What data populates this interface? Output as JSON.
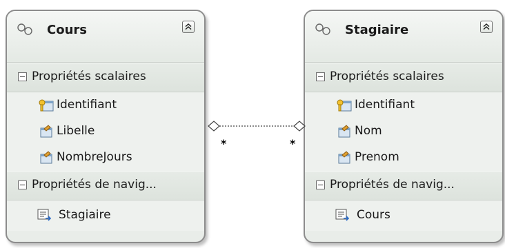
{
  "entities": [
    {
      "title": "Cours",
      "sections": {
        "scalar_label": "Propriétés scalaires",
        "nav_label": "Propriétés de navig..."
      },
      "properties": [
        {
          "name": "Identifiant",
          "icon": "key-property-icon"
        },
        {
          "name": "Libelle",
          "icon": "property-icon"
        },
        {
          "name": "NombreJours",
          "icon": "property-icon"
        }
      ],
      "navigation": [
        {
          "name": "Stagiaire",
          "icon": "navigation-property-icon"
        }
      ]
    },
    {
      "title": "Stagiaire",
      "sections": {
        "scalar_label": "Propriétés scalaires",
        "nav_label": "Propriétés de navig..."
      },
      "properties": [
        {
          "name": "Identifiant",
          "icon": "key-property-icon"
        },
        {
          "name": "Nom",
          "icon": "property-icon"
        },
        {
          "name": "Prenom",
          "icon": "property-icon"
        }
      ],
      "navigation": [
        {
          "name": "Cours",
          "icon": "navigation-property-icon"
        }
      ]
    }
  ],
  "association": {
    "left_multiplicity": "*",
    "right_multiplicity": "*"
  }
}
